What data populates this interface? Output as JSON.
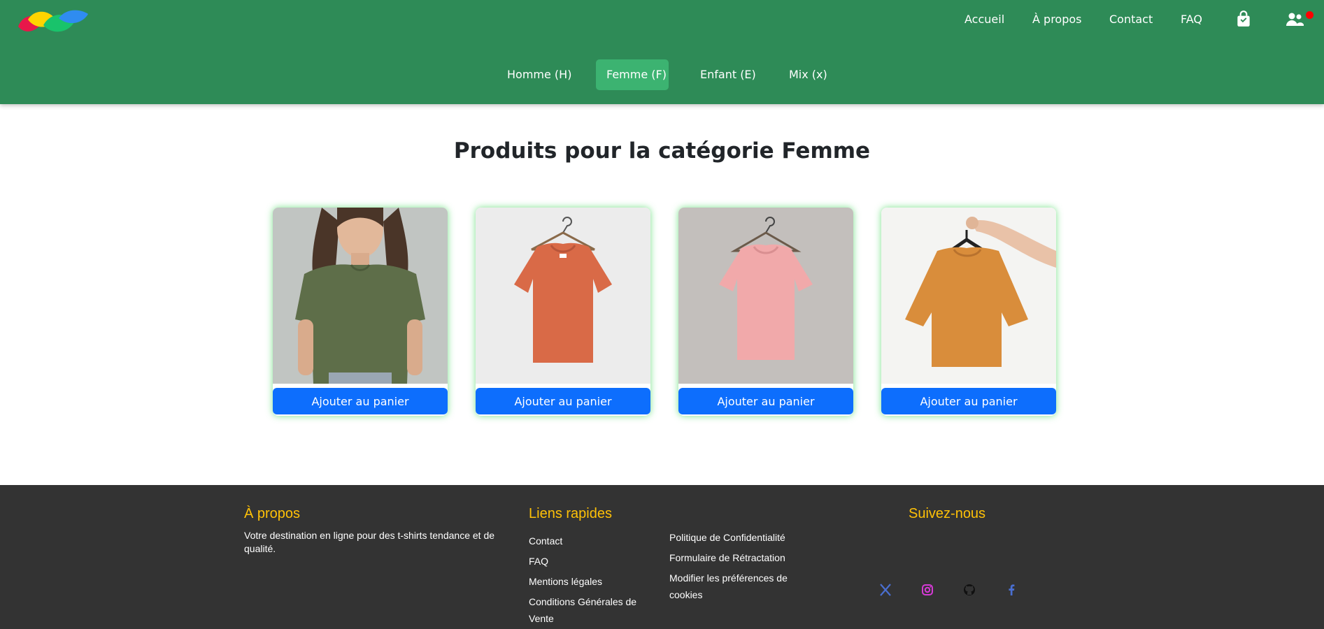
{
  "header": {
    "nav": [
      "Accueil",
      "À propos",
      "Contact",
      "FAQ"
    ],
    "cart_icon": "shopping-bag-icon",
    "account_icon": "users-icon",
    "notification_color": "#ff0000",
    "categories": [
      "Homme (H)",
      "Femme (F)",
      "Enfant (E)",
      "Mix (x)"
    ],
    "active_category": "Femme (F)",
    "colors": {
      "header_bg": "#2e8b57",
      "active_tab": "#3cb371"
    }
  },
  "main": {
    "title": "Produits pour la catégorie Femme",
    "products": [
      {
        "image": "woman-olive-tshirt",
        "button": "Ajouter au panier"
      },
      {
        "image": "orange-tshirt-on-hanger",
        "button": "Ajouter au panier"
      },
      {
        "image": "pink-tshirt-on-hanger",
        "button": "Ajouter au panier"
      },
      {
        "image": "orange-tshirt-held-by-hand",
        "button": "Ajouter au panier"
      }
    ],
    "button_color": "#0d6efd"
  },
  "footer": {
    "about": {
      "title": "À propos",
      "text": "Votre destination en ligne pour des t-shirts tendance et de qualité."
    },
    "links": {
      "title": "Liens rapides",
      "col1": [
        "Contact",
        "FAQ",
        "Mentions légales",
        "Conditions Générales de Vente"
      ],
      "col2": [
        "Politique de Confidentialité",
        "Formulaire de Rétractation",
        "Modifier les préférences de cookies"
      ]
    },
    "follow": {
      "title": "Suivez-nous",
      "icons": [
        "x-icon",
        "instagram-icon",
        "github-icon",
        "facebook-icon"
      ]
    },
    "colors": {
      "background": "#333333",
      "heading": "#ffc107"
    }
  }
}
